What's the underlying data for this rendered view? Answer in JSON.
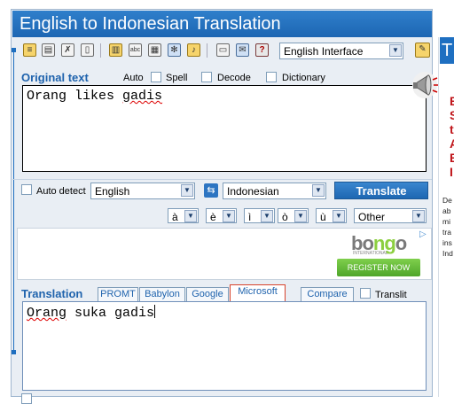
{
  "app": {
    "title": "English to Indonesian Translation"
  },
  "toolbar": {
    "icons": [
      "notes-icon",
      "document-icon",
      "eraser-icon",
      "trash-icon",
      "book-icon",
      "spellcheck-icon",
      "keyboard-icon",
      "settings-icon",
      "speaker-icon",
      "print-icon",
      "email-icon",
      "help-icon"
    ],
    "interface_select": "English Interface"
  },
  "original": {
    "label": "Original text",
    "auto_label": "Auto",
    "spell_label": "Spell",
    "decode_label": "Decode",
    "dictionary_label": "Dictionary",
    "text_plain_1": "Orang likes ",
    "text_squiggle": "gadis"
  },
  "languages": {
    "auto_detect_label": "Auto detect",
    "source": "English",
    "target": "Indonesian",
    "translate_label": "Translate"
  },
  "accents": [
    "à",
    "è",
    "ì",
    "ò",
    "ù"
  ],
  "accents_other": "Other",
  "ad": {
    "brand_a": "bo",
    "brand_b": "ng",
    "brand_c": "o",
    "brand_sub": "INTERNATIONAL",
    "register_label": "REGISTER NOW"
  },
  "translation": {
    "label": "Translation",
    "tabs": [
      "PROMT",
      "Babylon",
      "Google",
      "Microsoft"
    ],
    "active_tab": "Microsoft",
    "compare_label": "Compare",
    "translit_label": "Translit",
    "result_squiggle": "Orang",
    "result_rest": " suka gadis"
  },
  "side": {
    "header": "T",
    "red_lines": [
      "E",
      "S",
      "t",
      "A",
      "E",
      "I"
    ],
    "text_lines": [
      "De",
      "ab",
      "mi",
      "tra",
      "ins",
      "Ind"
    ]
  },
  "colors": {
    "accent": "#1f63ad",
    "title_bar": "#2f7fcb",
    "active_tab_border": "#d7432c",
    "ad_green": "#8ccf40"
  }
}
